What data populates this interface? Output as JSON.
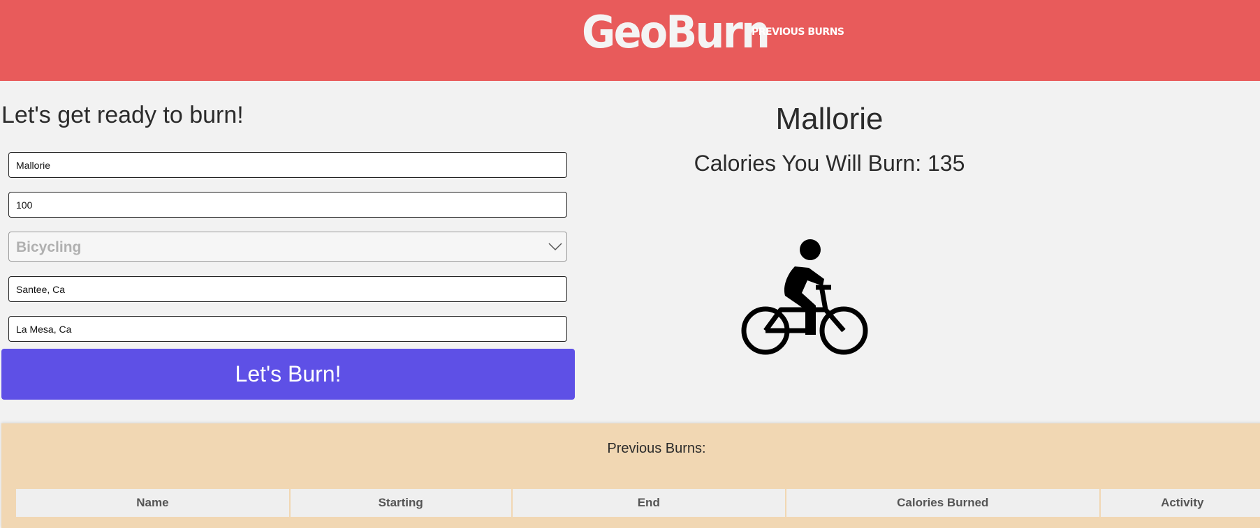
{
  "header": {
    "logo": "GeoBurn",
    "nav_previous_burns": "PREVIOUS BURNS"
  },
  "form": {
    "title": "Let's get ready to burn!",
    "name_value": "Mallorie",
    "weight_value": "100",
    "activity_selected": "Bicycling",
    "start_value": "Santee, Ca",
    "end_value": "La Mesa, Ca",
    "submit_label": "Let's Burn!"
  },
  "result": {
    "name": "Mallorie",
    "calories_text": "Calories You Will Burn: 135",
    "activity_icon": "bicycle-rider-icon"
  },
  "history": {
    "title": "Previous Burns:",
    "columns": [
      "Name",
      "Starting",
      "End",
      "Calories Burned",
      "Activity"
    ]
  },
  "colors": {
    "header_bg": "#e85b5b",
    "button_bg": "#5e50e6",
    "history_bg": "#f1d7b3",
    "page_bg": "#f2f2f2"
  }
}
